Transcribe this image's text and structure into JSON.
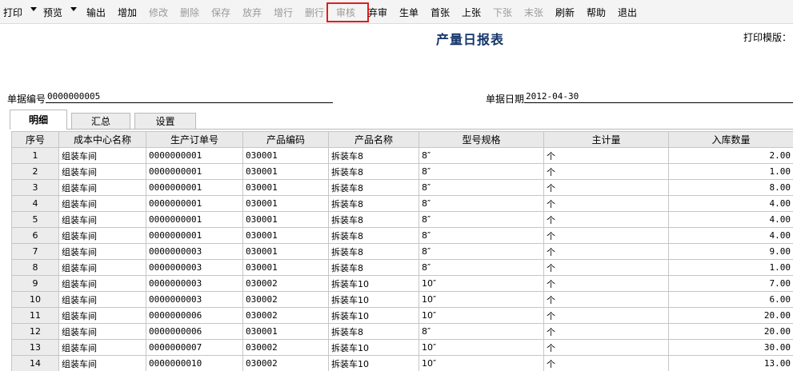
{
  "toolbar": {
    "print": "打印",
    "preview": "预览",
    "output": "输出",
    "add": "增加",
    "edit": "修改",
    "delete": "删除",
    "save": "保存",
    "discard": "放弃",
    "add_row": "增行",
    "delete_row": "删行",
    "audit": "审核",
    "unaudit": "弃审",
    "generate": "生单",
    "first": "首张",
    "prev": "上张",
    "next": "下张",
    "last": "末张",
    "refresh": "刷新",
    "help": "帮助",
    "exit": "退出",
    "highlight_color": "#e31c1c"
  },
  "header": {
    "title": "产量日报表",
    "print_template_label": "打印模版：",
    "doc_no_label": "单据编号",
    "doc_no_value": "0000000005",
    "doc_date_label": "单据日期",
    "doc_date_value": "2012-04-30"
  },
  "tabs": [
    {
      "label": "明细",
      "active": true
    },
    {
      "label": "汇总",
      "active": false
    },
    {
      "label": "设置",
      "active": false
    }
  ],
  "grid": {
    "columns": [
      "序号",
      "成本中心名称",
      "生产订单号",
      "产品编码",
      "产品名称",
      "型号规格",
      "主计量",
      "入库数量"
    ],
    "rows": [
      [
        "1",
        "组装车间",
        "0000000001",
        "030001",
        "拆装车8",
        "8″",
        "个",
        "2.00"
      ],
      [
        "2",
        "组装车间",
        "0000000001",
        "030001",
        "拆装车8",
        "8″",
        "个",
        "1.00"
      ],
      [
        "3",
        "组装车间",
        "0000000001",
        "030001",
        "拆装车8",
        "8″",
        "个",
        "8.00"
      ],
      [
        "4",
        "组装车间",
        "0000000001",
        "030001",
        "拆装车8",
        "8″",
        "个",
        "4.00"
      ],
      [
        "5",
        "组装车间",
        "0000000001",
        "030001",
        "拆装车8",
        "8″",
        "个",
        "4.00"
      ],
      [
        "6",
        "组装车间",
        "0000000001",
        "030001",
        "拆装车8",
        "8″",
        "个",
        "4.00"
      ],
      [
        "7",
        "组装车间",
        "0000000003",
        "030001",
        "拆装车8",
        "8″",
        "个",
        "9.00"
      ],
      [
        "8",
        "组装车间",
        "0000000003",
        "030001",
        "拆装车8",
        "8″",
        "个",
        "1.00"
      ],
      [
        "9",
        "组装车间",
        "0000000003",
        "030002",
        "拆装车10",
        "10″",
        "个",
        "7.00"
      ],
      [
        "10",
        "组装车间",
        "0000000003",
        "030002",
        "拆装车10",
        "10″",
        "个",
        "6.00"
      ],
      [
        "11",
        "组装车间",
        "0000000006",
        "030002",
        "拆装车10",
        "10″",
        "个",
        "20.00"
      ],
      [
        "12",
        "组装车间",
        "0000000006",
        "030001",
        "拆装车8",
        "8″",
        "个",
        "20.00"
      ],
      [
        "13",
        "组装车间",
        "0000000007",
        "030002",
        "拆装车10",
        "10″",
        "个",
        "30.00"
      ],
      [
        "14",
        "组装车间",
        "0000000010",
        "030002",
        "拆装车10",
        "10″",
        "个",
        "13.00"
      ]
    ]
  }
}
